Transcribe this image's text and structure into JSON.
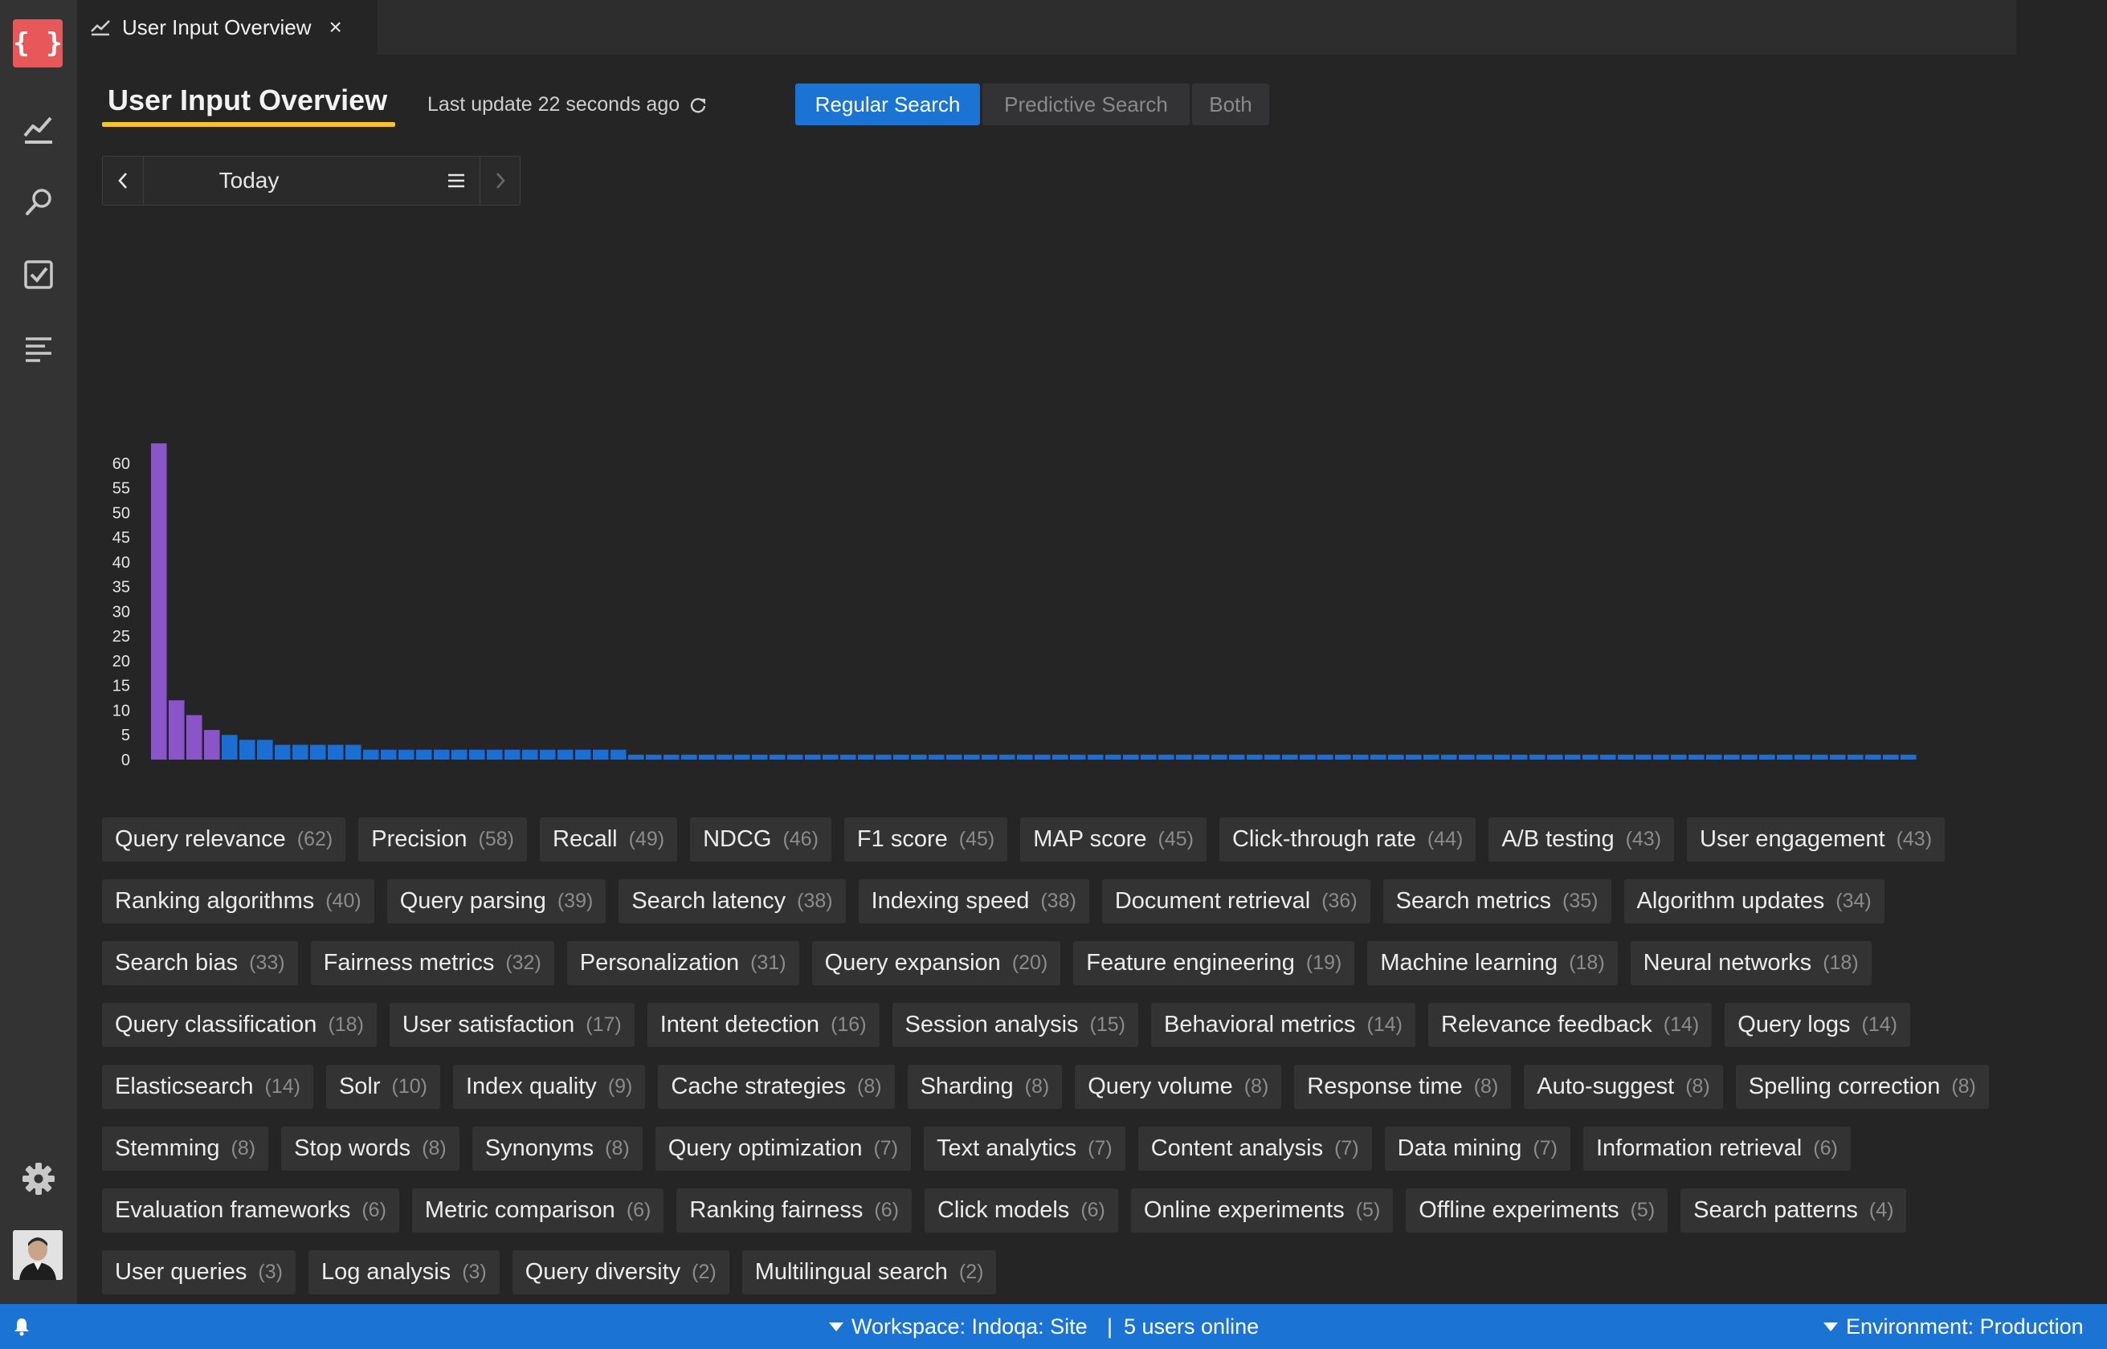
{
  "app": {
    "logo_glyph": "{ }"
  },
  "activity_bar": {
    "items": [
      {
        "name": "chart-icon"
      },
      {
        "name": "search-icon"
      },
      {
        "name": "checkbox-icon"
      },
      {
        "name": "list-icon"
      }
    ],
    "bottom": [
      {
        "name": "gear-icon"
      },
      {
        "name": "avatar"
      }
    ]
  },
  "tab": {
    "title": "User Input Overview",
    "icon": "chart-line-icon",
    "close": "×"
  },
  "header": {
    "title": "User Input Overview",
    "last_update": "Last update 22 seconds ago",
    "accent_color": "#f6c32c"
  },
  "search_mode": {
    "options": [
      "Regular Search",
      "Predictive Search",
      "Both"
    ],
    "selected": "Regular Search"
  },
  "date_nav": {
    "label": "Today",
    "prev_icon": "chevron-left-icon",
    "menu_icon": "menu-icon",
    "next_icon": "chevron-right-icon"
  },
  "chart_data": {
    "type": "bar",
    "ylim": [
      0,
      65
    ],
    "yticks": [
      0,
      5,
      10,
      15,
      20,
      25,
      30,
      35,
      40,
      45,
      50,
      55,
      60
    ],
    "values": [
      64,
      12,
      9,
      6,
      5,
      4,
      4,
      3,
      3,
      3,
      3,
      3,
      2,
      2,
      2,
      2,
      2,
      2,
      2,
      2,
      2,
      2,
      2,
      2,
      2,
      2,
      2,
      1,
      1,
      1,
      1,
      1,
      1,
      1,
      1,
      1,
      1,
      1,
      1,
      1,
      1,
      1,
      1,
      1,
      1,
      1,
      1,
      1,
      1,
      1,
      1,
      1,
      1,
      1,
      1,
      1,
      1,
      1,
      1,
      1,
      1,
      1,
      1,
      1,
      1,
      1,
      1,
      1,
      1,
      1,
      1,
      1,
      1,
      1,
      1,
      1,
      1,
      1,
      1,
      1,
      1,
      1,
      1,
      1,
      1,
      1,
      1,
      1,
      1,
      1,
      1,
      1,
      1,
      1,
      1,
      1,
      1,
      1,
      1,
      1
    ],
    "colors": {
      "highlight": "#8a55c9",
      "default": "#1b6ed2"
    },
    "highlight_count": 4,
    "grid": false
  },
  "tags": [
    {
      "label": "Query relevance",
      "count": "(62)"
    },
    {
      "label": "Precision",
      "count": "(58)"
    },
    {
      "label": "Recall",
      "count": "(49)"
    },
    {
      "label": "NDCG",
      "count": "(46)"
    },
    {
      "label": "F1 score",
      "count": "(45)"
    },
    {
      "label": "MAP score",
      "count": "(45)"
    },
    {
      "label": "Click-through rate",
      "count": "(44)"
    },
    {
      "label": "A/B testing",
      "count": "(43)"
    },
    {
      "label": "User engagement",
      "count": "(43)"
    },
    {
      "label": "Ranking algorithms",
      "count": "(40)"
    },
    {
      "label": "Query parsing",
      "count": "(39)"
    },
    {
      "label": "Search latency",
      "count": "(38)"
    },
    {
      "label": "Indexing speed",
      "count": "(38)"
    },
    {
      "label": "Document retrieval",
      "count": "(36)"
    },
    {
      "label": "Search metrics",
      "count": "(35)"
    },
    {
      "label": "Algorithm updates",
      "count": "(34)"
    },
    {
      "label": "Search bias",
      "count": "(33)"
    },
    {
      "label": "Fairness metrics",
      "count": "(32)"
    },
    {
      "label": "Personalization",
      "count": "(31)"
    },
    {
      "label": "Query expansion",
      "count": "(20)"
    },
    {
      "label": "Feature engineering",
      "count": "(19)"
    },
    {
      "label": "Machine learning",
      "count": "(18)"
    },
    {
      "label": "Neural networks",
      "count": "(18)"
    },
    {
      "label": "Query classification",
      "count": "(18)"
    },
    {
      "label": "User satisfaction",
      "count": "(17)"
    },
    {
      "label": "Intent detection",
      "count": "(16)"
    },
    {
      "label": "Session analysis",
      "count": "(15)"
    },
    {
      "label": "Behavioral metrics",
      "count": "(14)"
    },
    {
      "label": "Relevance feedback",
      "count": "(14)"
    },
    {
      "label": "Query logs",
      "count": "(14)"
    },
    {
      "label": "Elasticsearch",
      "count": "(14)"
    },
    {
      "label": "Solr",
      "count": "(10)"
    },
    {
      "label": "Index quality",
      "count": "(9)"
    },
    {
      "label": "Cache strategies",
      "count": "(8)"
    },
    {
      "label": "Sharding",
      "count": "(8)"
    },
    {
      "label": "Query volume",
      "count": "(8)"
    },
    {
      "label": "Response time",
      "count": "(8)"
    },
    {
      "label": "Auto-suggest",
      "count": "(8)"
    },
    {
      "label": "Spelling correction",
      "count": "(8)"
    },
    {
      "label": "Stemming",
      "count": "(8)"
    },
    {
      "label": "Stop words",
      "count": "(8)"
    },
    {
      "label": "Synonyms",
      "count": "(8)"
    },
    {
      "label": "Query optimization",
      "count": "(7)"
    },
    {
      "label": "Text analytics",
      "count": "(7)"
    },
    {
      "label": "Content analysis",
      "count": "(7)"
    },
    {
      "label": "Data mining",
      "count": "(7)"
    },
    {
      "label": "Information retrieval",
      "count": "(6)"
    },
    {
      "label": "Evaluation frameworks",
      "count": "(6)"
    },
    {
      "label": "Metric comparison",
      "count": "(6)"
    },
    {
      "label": "Ranking fairness",
      "count": "(6)"
    },
    {
      "label": "Click models",
      "count": "(6)"
    },
    {
      "label": "Online experiments",
      "count": "(5)"
    },
    {
      "label": "Offline experiments",
      "count": "(5)"
    },
    {
      "label": "Search patterns",
      "count": "(4)"
    },
    {
      "label": "User queries",
      "count": "(3)"
    },
    {
      "label": "Log analysis",
      "count": "(3)"
    },
    {
      "label": "Query diversity",
      "count": "(2)"
    },
    {
      "label": "Multilingual search",
      "count": "(2)"
    }
  ],
  "status_bar": {
    "workspace": "Workspace: Indoqa: Site",
    "separator": "|",
    "users_online": "5 users online",
    "environment": "Environment: Production",
    "bell_icon": "bell-icon",
    "color": "#1b73d4"
  }
}
